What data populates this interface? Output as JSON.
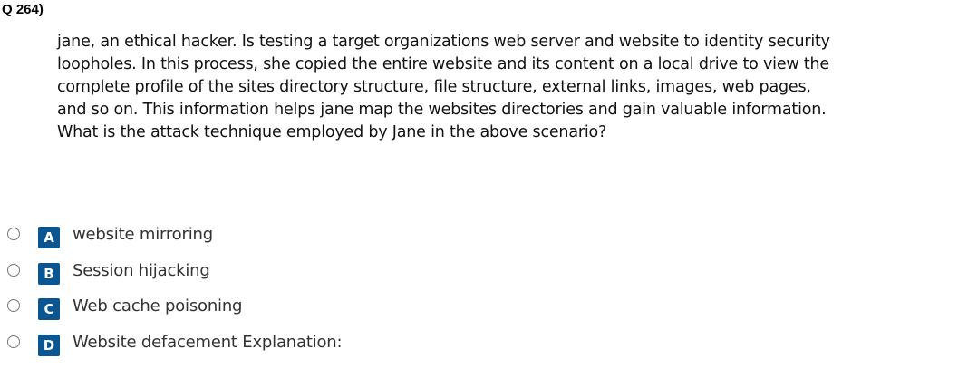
{
  "question": {
    "number": "Q 264)",
    "lines": [
      "jane, an ethical hacker. Is testing a target organizations web server and website to identity security",
      "loopholes. In this process, she copied the entire website and its content on a local drive to view the",
      "complete profile of the sites directory structure, file structure, external links, images, web pages,",
      "and so on. This information helps jane map the websites directories and gain valuable information.",
      "What is the attack technique employed by Jane in the above scenario?"
    ]
  },
  "options": [
    {
      "letter": "A",
      "text": "website mirroring"
    },
    {
      "letter": "B",
      "text": "Session hijacking"
    },
    {
      "letter": "C",
      "text": "Web cache poisoning"
    },
    {
      "letter": "D",
      "text": "Website defacement Explanation:"
    }
  ],
  "colors": {
    "badge": "#0b5590"
  }
}
